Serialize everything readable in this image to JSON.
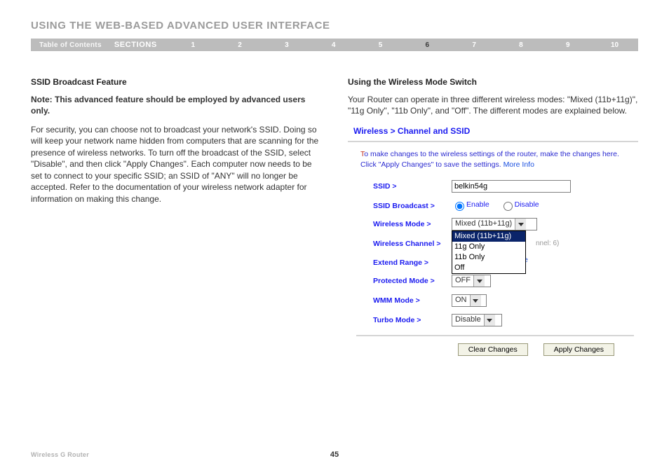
{
  "page": {
    "title": "USING THE WEB-BASED ADVANCED USER INTERFACE",
    "toc_label": "Table of Contents",
    "sections_label": "SECTIONS",
    "section_numbers": [
      "1",
      "2",
      "3",
      "4",
      "5",
      "6",
      "7",
      "8",
      "9",
      "10"
    ],
    "active_section": "6",
    "footer_name": "Wireless G Router",
    "page_number": "45"
  },
  "left": {
    "heading": "SSID Broadcast Feature",
    "note": "Note: This advanced feature should be employed by advanced users only.",
    "body": "For security, you can choose not to broadcast your network's SSID. Doing so will keep your network name hidden from computers that are scanning for the presence of wireless networks. To turn off the broadcast of the SSID, select \"Disable\", and then click \"Apply Changes\". Each computer now needs to be set to connect to your specific SSID; an SSID of \"ANY\" will no longer be accepted. Refer to the documentation of your wireless network adapter for information on making this change."
  },
  "right": {
    "heading": "Using the Wireless Mode Switch",
    "body": "Your Router can operate in three different wireless modes: \"Mixed (11b+11g)\", \"11g Only\", \"11b Only\", and \"Off\". The different modes are explained below."
  },
  "router": {
    "breadcrumb": "Wireless > Channel and SSID",
    "intro_cap": "T",
    "intro_rest": "o make changes to the wireless settings of the router, make the changes here. Click \"Apply Changes\" to save the settings. ",
    "more_info": "More Info",
    "labels": {
      "ssid": "SSID >",
      "ssid_broadcast": "SSID Broadcast >",
      "wireless_mode": "Wireless Mode >",
      "wireless_channel": "Wireless Channel >",
      "extend_range": "Extend Range >",
      "protected_mode": "Protected Mode >",
      "wmm_mode": "WMM Mode >",
      "turbo_mode": "Turbo Mode >"
    },
    "ssid_value": "belkin54g",
    "ssid_broadcast": {
      "enable": "Enable",
      "disable": "Disable",
      "selected": "enable"
    },
    "wireless_mode": {
      "selected": "Mixed (11b+11g)",
      "options": [
        "Mixed (11b+11g)",
        "11g Only",
        "11b Only",
        "Off"
      ]
    },
    "channel_hint": "nnel: 6)",
    "extend_tail": "e",
    "protected_mode": "OFF",
    "wmm_mode": "ON",
    "turbo_mode": "Disable",
    "buttons": {
      "clear": "Clear Changes",
      "apply": "Apply Changes"
    }
  }
}
